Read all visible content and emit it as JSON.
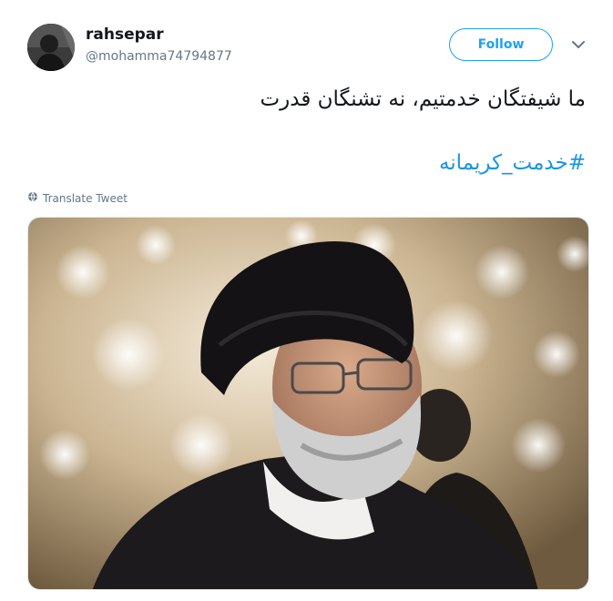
{
  "user": {
    "display_name": "rahsepar",
    "handle": "@mohamma74794877"
  },
  "actions": {
    "follow_label": "Follow",
    "menu_icon": "chevron-down-icon"
  },
  "tweet": {
    "text": "ما شیفتگان خدمتیم، نه تشنگان قدرت",
    "hashtag": "#خدمت_کریمانه"
  },
  "translate": {
    "label": "Translate Tweet",
    "icon": "globe-icon"
  },
  "colors": {
    "accent": "#1da1f2",
    "hashtag": "#1b95e0",
    "muted": "#657786",
    "text": "#14171a"
  }
}
